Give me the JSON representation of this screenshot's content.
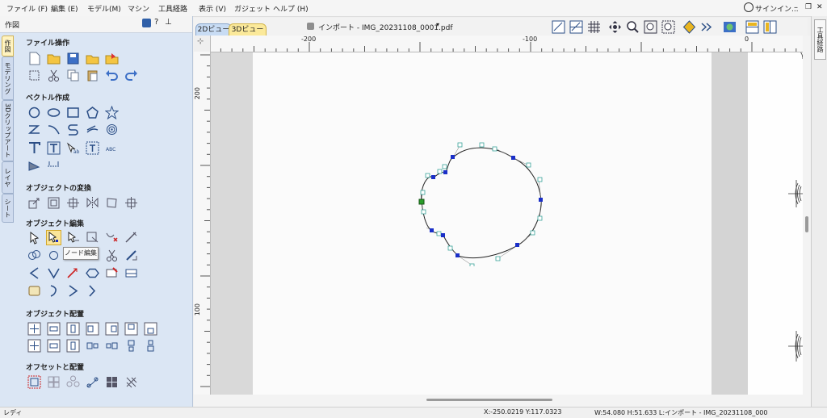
{
  "menu": [
    "ファイル (F)",
    "編集 (E)",
    "モデル(M)",
    "マシン",
    "工具経路",
    "表示 (V)",
    "ガジェット",
    "ヘルプ (H)"
  ],
  "signin": "サインイン...",
  "panel": {
    "title": "作図",
    "vtabs": [
      "作図",
      "モデリング",
      "3Dクリップアート",
      "レイヤ",
      "シート"
    ],
    "groups": [
      "ファイル操作",
      "ベクトル作成",
      "オブジェクトの変換",
      "オブジェクト編集",
      "オブジェクト配置",
      "オフセットと配置"
    ],
    "tooltip": "ノード編集"
  },
  "doc": {
    "tab_2d": "2Dビュー",
    "tab_3d": "3Dビュー",
    "title": "インポート - IMG_20231108_0001.pdf"
  },
  "ruler": {
    "h_labels": [
      "-200",
      "-100",
      "0"
    ],
    "v_labels": [
      "200",
      "100"
    ]
  },
  "dock": {
    "right_tab": "工具経路"
  },
  "status": {
    "left": "レディ",
    "coords": "X:-250.0219 Y:117.0323",
    "info": "W:54.080  H:51.633  L:インポート - IMG_20231108_000"
  },
  "colors": {
    "panel_bg": "#dbe6f4",
    "node": "#1a2fc8",
    "start_node": "#2a9d2a",
    "handle": "#3aa39a",
    "selected_tool": "#fbe59a"
  }
}
